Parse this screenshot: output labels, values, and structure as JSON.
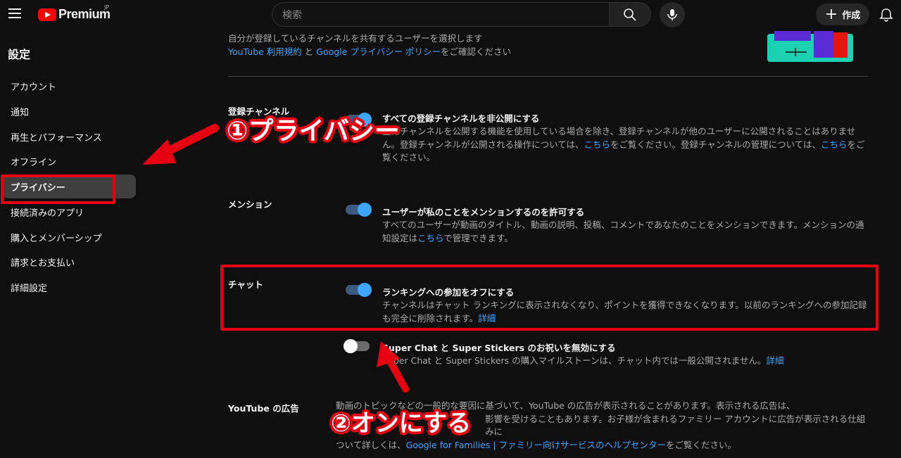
{
  "header": {
    "brand": "Premium",
    "region": "JP",
    "search_placeholder": "検索",
    "create_label": "作成"
  },
  "sidebar": {
    "title": "設定",
    "items": [
      {
        "label": "アカウント"
      },
      {
        "label": "通知"
      },
      {
        "label": "再生とパフォーマンス"
      },
      {
        "label": "オフライン"
      },
      {
        "label": "プライバシー",
        "active": true
      },
      {
        "label": "接続済みのアプリ"
      },
      {
        "label": "購入とメンバーシップ"
      },
      {
        "label": "請求とお支払い"
      },
      {
        "label": "詳細設定"
      }
    ]
  },
  "intro": {
    "line1": "自分が登録しているチャンネルを共有するユーザーを選択します",
    "terms_link": "YouTube 利用規約",
    "and": " と ",
    "policy_link": "Google プライバシー ポリシー",
    "suffix": "をご確認ください"
  },
  "sections": {
    "subscriptions": {
      "label": "登録チャンネル",
      "title": "すべての登録チャンネルを非公開にする",
      "desc_a": "登録チャンネルを公開する機能を使用している場合を除き、登録チャンネルが他のユーザーに公開されることはありません。登録チャンネルが公開される操作については、",
      "link1": "こちら",
      "desc_b": "をご覧ください。登録チャンネルの管理については、",
      "link2": "こちら",
      "desc_c": "をご覧ください。"
    },
    "mentions": {
      "label": "メンション",
      "title": "ユーザーが私のことをメンションするのを許可する",
      "desc_a": "すべてのユーザーが動画のタイトル、動画の説明、投稿、コメントであなたのことをメンションできます。メンションの通知設定は",
      "link": "こちら",
      "desc_b": "で管理できます。",
      "enabled": true
    },
    "chat": {
      "label": "チャット",
      "ranking_title": "ランキングへの参加をオフにする",
      "ranking_desc": "チャンネルはチャット ランキングに表示されなくなり、ポイントを獲得できなくなります。以前のランキングへの参加記録も完全に削除されます。",
      "ranking_link": "詳細",
      "ranking_enabled": true,
      "superchat_title": "Super Chat と Super Stickers のお祝いを無効にする",
      "superchat_desc": "Super Chat と Super Stickers の購入マイルストーンは、チャット内では一般公開されません。",
      "superchat_link": "詳細",
      "superchat_enabled": false
    },
    "ads": {
      "label": "YouTube の広告",
      "line1": "動画のトピックなどの一般的な要因に基づいて、YouTube の広告が表示されることがあります。表示される広告は、",
      "line2": "影響を受けることもあります。お子様が含まれるファミリー アカウントに広告が表示される仕組みに",
      "line3_prefix": "ついて詳しくは、",
      "link": "Google for Families | ファミリー向けサービスのヘルプセンター",
      "line3_suffix": "をご覧ください。"
    }
  },
  "annotations": {
    "step1": "①プライバシー",
    "step2": "②オンにする",
    "color": "#e60012"
  }
}
